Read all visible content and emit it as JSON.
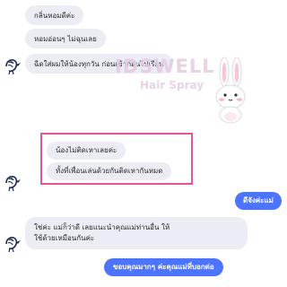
{
  "messages": [
    {
      "text": "กลิ่นหอมดีค่ะ"
    },
    {
      "text": "หอมอ่อนๆ ไม่ฉุนเลย"
    },
    {
      "text": "ฉีดใส่ผมให้น้องทุกวัน ก่อนเข้าก่อนไปเรียน"
    },
    {
      "text": "น้องไม่ติดเหาเลยค่ะ"
    },
    {
      "text": "ทั้งที่เพื่อนเล่นด้วยกันติดเหากันหมด"
    },
    {
      "text": "ดีจังค่ะแม่"
    },
    {
      "text": "ใช่ค่ะ แม่ก็ว่าดี เลยแนะนำคุณแม่ท่านอื่น ให้"
    },
    {
      "text": "ใช้ด้วยเหมือนกันค่ะ"
    },
    {
      "text": "ขอบคุณมากๆ ค่ะคุณแม่ที่บอกต่อ"
    }
  ],
  "watermark": {
    "brand": "IDSWELL",
    "sub": "Hair Spray"
  },
  "colors": {
    "incoming_bubble": "#ececf5",
    "outgoing_bubble": "#4d74ff",
    "highlight": "#e0569a"
  },
  "icons": {
    "avatar": "sketch-bird-icon",
    "sticker": "bunny-sticker-icon"
  }
}
